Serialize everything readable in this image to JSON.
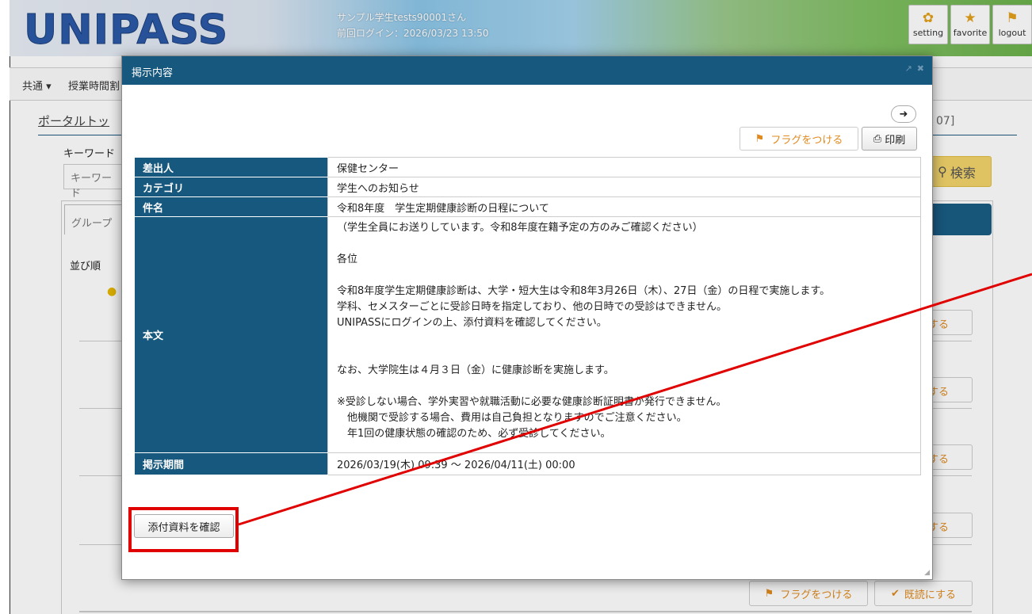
{
  "header": {
    "logo": "UNIPASS",
    "user_line": "サンプル学生tests90001さん",
    "last_login": "前回ログイン：2026/03/23 13:50",
    "buttons": [
      {
        "label": "setting",
        "icon": "gear-icon",
        "glyph": "✿"
      },
      {
        "label": "favorite",
        "icon": "star-icon",
        "glyph": "★"
      },
      {
        "label": "logout",
        "icon": "runner-icon",
        "glyph": "⚑"
      }
    ]
  },
  "nav": {
    "common": "共通 ▾",
    "class_time": "授業時間割"
  },
  "page": {
    "breadcrumb": "ポータルトッ",
    "breadcrumb_right": "07]",
    "keyword_label": "キーワード",
    "keyword_placeholder": "キーワード",
    "search_label": "検索",
    "group_tab": "グループ",
    "sort_label": "並び順",
    "row_read_label": "する",
    "bottom_flag": "フラグをつける",
    "bottom_read": "既読にする"
  },
  "modal": {
    "title": "掲示内容",
    "flag_label": "フラグをつける",
    "print_label": "印刷",
    "rows": {
      "sender_label": "差出人",
      "sender_value": "保健センター",
      "category_label": "カテゴリ",
      "category_value": "学生へのお知らせ",
      "subject_label": "件名",
      "subject_value": "令和8年度　学生定期健康診断の日程について",
      "body_label": "本文",
      "period_label": "掲示期間",
      "period_value": "2026/03/19(木) 09:39 ～ 2026/04/11(土) 00:00"
    },
    "body_lines": [
      "（学生全員にお送りしています。令和8年度在籍予定の方のみご確認ください）",
      "",
      "各位",
      "",
      "令和8年度学生定期健康診断は、大学・短大生は令和8年3月26日（木）、27日（金）の日程で実施します。",
      "学科、セメスターごとに受診日時を指定しており、他の日時での受診はできません。",
      "UNIPASSにログインの上、添付資料を確認してください。",
      "",
      "",
      "なお、大学院生は４月３日（金）に健康診断を実施します。",
      "",
      "※受診しない場合、学外実習や就職活動に必要な健康診断証明書が発行できません。",
      "　他機関で受診する場合、費用は自己負担となりますのでご注意ください。",
      "　年1回の健康状態の確認のため、必ず受診してください。"
    ],
    "attach_label": "添付資料を確認"
  },
  "colors": {
    "header_blue": "#17587e",
    "accent_orange": "#e08a1e",
    "annotation_red": "#e00000",
    "search_yellow": "#f2d46b"
  }
}
